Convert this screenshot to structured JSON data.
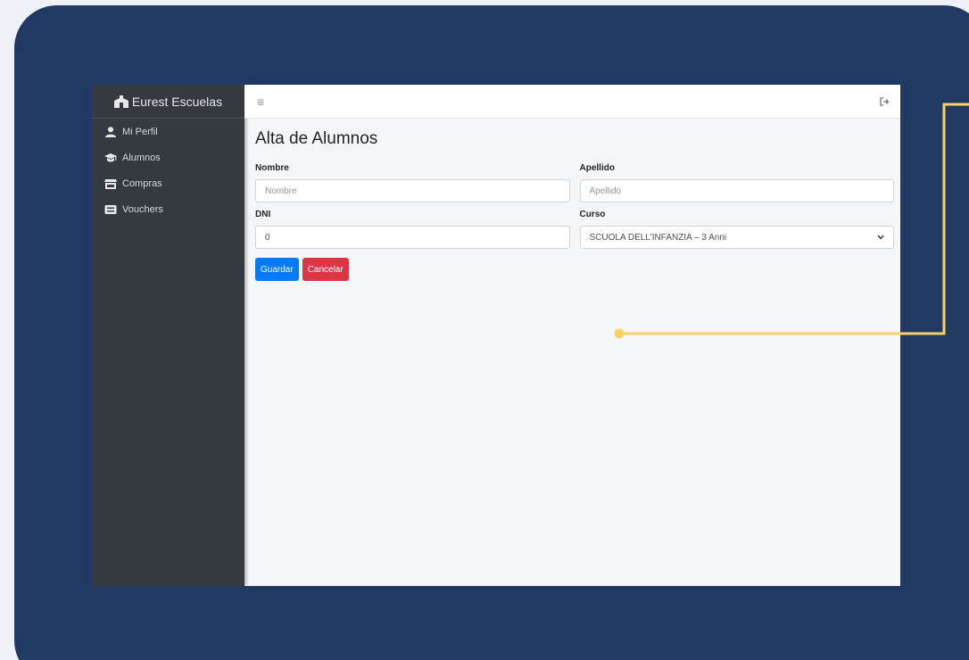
{
  "sidebar": {
    "brand": "Eurest Escuelas",
    "items": [
      {
        "label": "Mi Perfil",
        "icon": "user-icon"
      },
      {
        "label": "Alumnos",
        "icon": "graduation-cap-icon"
      },
      {
        "label": "Compras",
        "icon": "store-icon"
      },
      {
        "label": "Vouchers",
        "icon": "ticket-icon"
      }
    ]
  },
  "topbar": {
    "menu_icon": "hamburger-icon",
    "logout_icon": "logout-icon"
  },
  "main": {
    "title": "Alta de Alumnos",
    "fields": {
      "nombre": {
        "label": "Nombre",
        "placeholder": "Nombre",
        "value": ""
      },
      "apellido": {
        "label": "Apellido",
        "placeholder": "Apellido",
        "value": ""
      },
      "dni": {
        "label": "DNI",
        "value": "0"
      },
      "curso": {
        "label": "Curso",
        "selected": "SCUOLA DELL'INFANZIA – 3 Anni"
      }
    },
    "buttons": {
      "save": "Guardar",
      "cancel": "Cancelar"
    }
  },
  "colors": {
    "frame": "#213a63",
    "sidebar": "#343a40",
    "primary": "#007bff",
    "danger": "#dc3545",
    "callout": "#fcd266"
  }
}
